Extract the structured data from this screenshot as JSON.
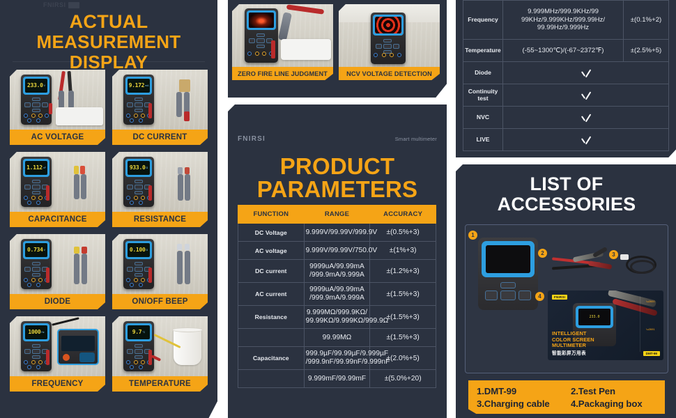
{
  "left": {
    "title_line1": "ACTUAL",
    "title_line2": "MEASUREMENT DISPLAY",
    "items": [
      {
        "label": "AC VOLTAGE",
        "reading": "233.0",
        "unit": "V"
      },
      {
        "label": "DC CURRENT",
        "reading": "9.172",
        "unit": "mA"
      },
      {
        "label": "CAPACITANCE",
        "reading": "1.112",
        "unit": "nF"
      },
      {
        "label": "RESISTANCE",
        "reading": "933.0",
        "unit": "Ω"
      },
      {
        "label": "DIODE",
        "reading": "0.734",
        "unit": "V"
      },
      {
        "label": "ON/OFF BEEP",
        "reading": "0.100",
        "unit": "Ω"
      },
      {
        "label": "FREQUENCY",
        "reading": "1000",
        "unit": "Hz"
      },
      {
        "label": "TEMPERATURE",
        "reading": "9.7",
        "unit": "°C"
      }
    ]
  },
  "middle": {
    "top_items": [
      {
        "label": "ZERO FIRE LINE JUDGMENT"
      },
      {
        "label": "NCV VOLTAGE DETECTION"
      }
    ],
    "brand": "FNIRSI",
    "brand_sub": "Smart multimeter",
    "title_line1": "PRODUCT",
    "title_line2": "PARAMETERS",
    "table": {
      "headers": [
        "FUNCTION",
        "RANGE",
        "ACCURACY"
      ],
      "rows": [
        {
          "function": "DC Voltage",
          "range": "9.999V/99.99V/999.9V",
          "accuracy": "±(0.5%+3)",
          "tall": false
        },
        {
          "function": "AC voltage",
          "range": "9.999V/99.99V/750.0V",
          "accuracy": "±(1%+3)",
          "tall": false
        },
        {
          "function": "DC current",
          "range": "9999uA/99.99mA\n/999.9mA/9.999A",
          "accuracy": "±(1.2%+3)",
          "tall": true
        },
        {
          "function": "AC current",
          "range": "9999uA/99.99mA\n/999.9mA/9.999A",
          "accuracy": "±(1.5%+3)",
          "tall": true
        },
        {
          "function": "Resistance",
          "range": "9.999MΩ/999.9KΩ/\n99.99KΩ/9.999KΩ/999.9Ω",
          "accuracy": "±(1.5%+3)",
          "tall": true
        },
        {
          "function": "",
          "range": "99.99MΩ",
          "accuracy": "±(1.5%+3)",
          "tall": false
        },
        {
          "function": "Capacitance",
          "range": "999.9µF/99.99µF/9.999µF\n/999.9nF/99.99nF/9.999nF",
          "accuracy": "±(2.0%+5)",
          "tall": true
        },
        {
          "function": "",
          "range": "9.999mF/99.99mF",
          "accuracy": "±(5.0%+20)",
          "tall": false
        }
      ]
    }
  },
  "right": {
    "table": {
      "rows": [
        {
          "function": "Frequency",
          "range": "9.999MHz/999.9KHz/99\n99KHz/9.999KHz/999.99Hz/\n99.99Hz/9.999Hz",
          "accuracy": "±(0.1%+2)",
          "check": false,
          "tall": true
        },
        {
          "function": "Temperature",
          "range": "(-55~1300℃)/(-67~2372℉)",
          "accuracy": "±(2.5%+5)",
          "check": false,
          "tall": false
        },
        {
          "function": "Diode",
          "range": "",
          "accuracy": "",
          "check": true,
          "tall": false
        },
        {
          "function": "Continuity\ntest",
          "range": "",
          "accuracy": "",
          "check": true,
          "tall": false
        },
        {
          "function": "NVC",
          "range": "",
          "accuracy": "",
          "check": true,
          "tall": false
        },
        {
          "function": "LIVE",
          "range": "",
          "accuracy": "",
          "check": true,
          "tall": false
        }
      ]
    },
    "accessories": {
      "title_line1": "LIST OF",
      "title_line2": "ACCESSORIES",
      "badges": [
        "1",
        "2",
        "3",
        "4"
      ],
      "list": [
        "1.DMT-99",
        "2.Test Pen",
        "3.Charging cable",
        "4.Packaging box"
      ],
      "package": {
        "brand": "FNIRSI",
        "text_line1": "INTELLIGENT",
        "text_line2": "COLOR SCREEN",
        "text_line3": "MULTIMETER",
        "text_cn": "智能彩屏万用表",
        "model": "DMT-99",
        "screen_value": "233.0"
      }
    }
  },
  "colors": {
    "panel_bg": "#2b3240",
    "accent_orange": "#f5a416",
    "text_white": "#ffffff",
    "table_border": "#4c5465",
    "device_blue": "#2d9ee0",
    "screen_yellow": "#e8d43a"
  }
}
